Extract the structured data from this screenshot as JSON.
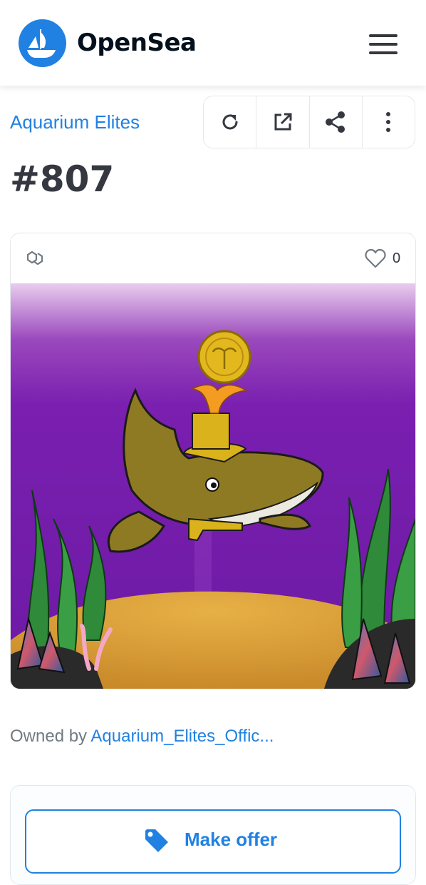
{
  "header": {
    "brand": "OpenSea",
    "logo_icon": "opensea-sailboat-icon",
    "menu_icon": "hamburger-menu-icon",
    "accent_color": "#2081e2"
  },
  "asset": {
    "collection": "Aquarium Elites",
    "title": "#807",
    "actions": [
      "refresh-icon",
      "external-link-icon",
      "share-icon",
      "more-vertical-icon"
    ],
    "chain_icon": "polygon-chain-icon",
    "favorites": "0",
    "owned_by_label": "Owned by",
    "owner": "Aquarium_Elites_Offic...",
    "artwork": "whale-with-top-hat-nft-image"
  },
  "offer": {
    "button_label": "Make offer",
    "icon": "price-tag-icon"
  }
}
